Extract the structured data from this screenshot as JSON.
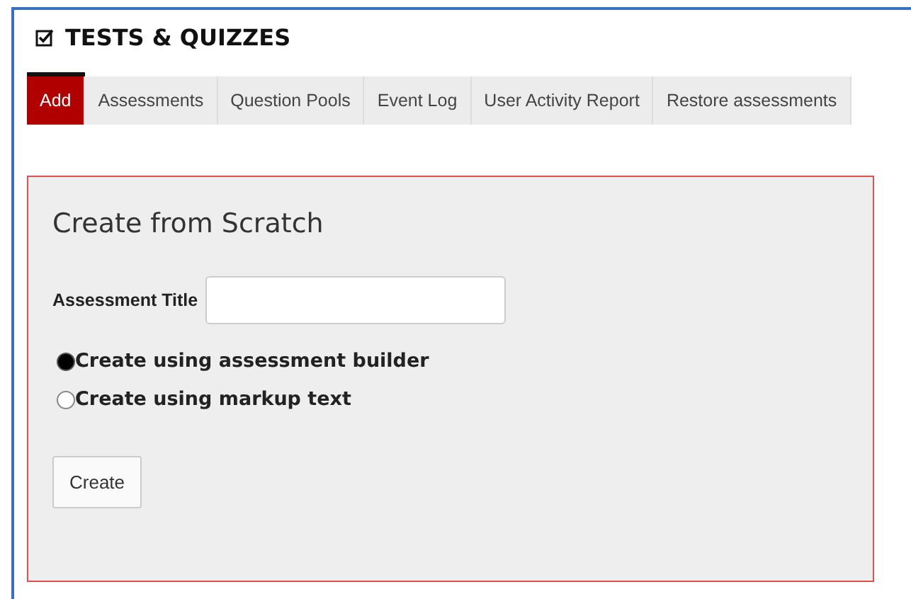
{
  "tool": {
    "title": "TESTS & QUIZZES"
  },
  "tabs": [
    {
      "label": "Add",
      "selected": true
    },
    {
      "label": "Assessments",
      "selected": false
    },
    {
      "label": "Question Pools",
      "selected": false
    },
    {
      "label": "Event Log",
      "selected": false
    },
    {
      "label": "User Activity Report",
      "selected": false
    },
    {
      "label": "Restore assessments",
      "selected": false
    }
  ],
  "panel": {
    "heading": "Create from Scratch",
    "field_label": "Assessment Title",
    "options": [
      {
        "label": "Create using assessment builder",
        "selected": true
      },
      {
        "label": "Create using markup text",
        "selected": false
      }
    ],
    "button": "Create"
  }
}
